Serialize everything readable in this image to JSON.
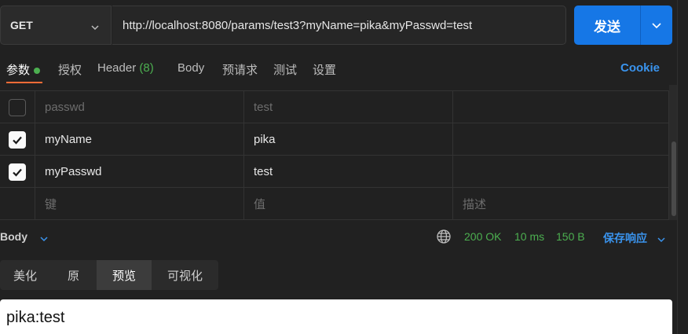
{
  "request": {
    "method": "GET",
    "url": "http://localhost:8080/params/test3?myName=pika&myPasswd=test",
    "send_label": "发送"
  },
  "tabs": [
    {
      "label": "参数",
      "active": true,
      "dot": true
    },
    {
      "label": "授权"
    },
    {
      "label": "Header",
      "count": "(8)"
    },
    {
      "label": "Body"
    },
    {
      "label": "预请求"
    },
    {
      "label": "测试"
    },
    {
      "label": "设置"
    }
  ],
  "cookie_label": "Cookie",
  "params": [
    {
      "checked": false,
      "key": "passwd",
      "value": "test",
      "description": ""
    },
    {
      "checked": true,
      "key": "myName",
      "value": "pika",
      "description": ""
    },
    {
      "checked": true,
      "key": "myPasswd",
      "value": "test",
      "description": ""
    }
  ],
  "params_placeholders": {
    "key": "键",
    "value": "值",
    "description": "描述"
  },
  "response": {
    "section_label": "Body",
    "status": "200 OK",
    "time": "10 ms",
    "size": "150 B",
    "save_label": "保存响应",
    "view_tabs": [
      "美化",
      "原",
      "预览",
      "可视化"
    ],
    "active_view": "预览",
    "body_text": "pika:test"
  },
  "colors": {
    "accent_send": "#1677e6",
    "tab_underline": "#ff6c37",
    "status_green": "#4caf50",
    "link_blue": "#3a94ee"
  }
}
